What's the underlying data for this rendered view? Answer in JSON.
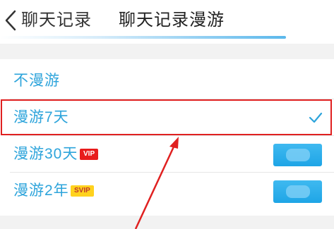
{
  "header": {
    "back_label": "聊天记录",
    "title": "聊天记录漫游"
  },
  "options": [
    {
      "label": "不漫游",
      "selected": false,
      "badge": "",
      "has_button": false
    },
    {
      "label": "漫游7天",
      "selected": true,
      "badge": "",
      "has_button": false
    },
    {
      "label": "漫游30天",
      "selected": false,
      "badge": "VIP",
      "has_button": true
    },
    {
      "label": "漫游2年",
      "selected": false,
      "badge": "SVIP",
      "has_button": true
    }
  ],
  "colors": {
    "accent": "#2da4db",
    "highlight": "#e02020",
    "vip_badge": "#e81c1c",
    "svip_badge": "#ffd21e",
    "button": "#1ea5e6"
  },
  "icons": {
    "back": "chevron-left-icon",
    "check": "check-icon",
    "annotation": "red-arrow"
  }
}
